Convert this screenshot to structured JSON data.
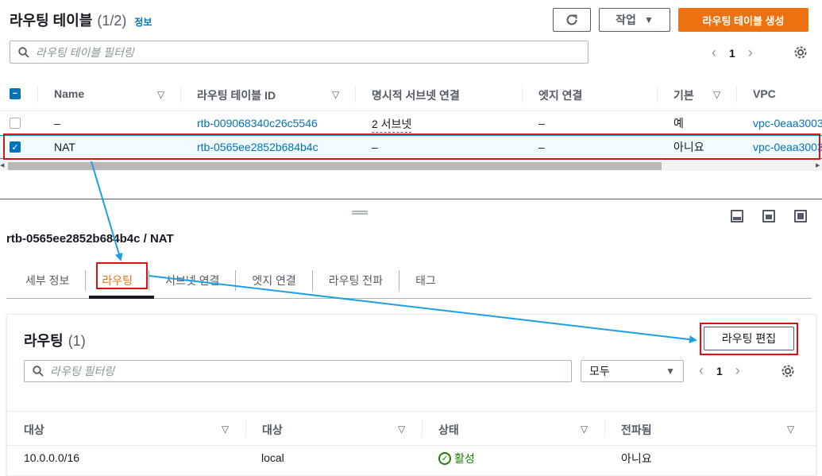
{
  "header": {
    "title": "라우팅 테이블",
    "count": "(1/2)",
    "info_link": "정보",
    "actions_label": "작업",
    "create_label": "라우팅 테이블 생성"
  },
  "search": {
    "placeholder": "라우팅 테이블 필터링"
  },
  "pagination": {
    "page": "1"
  },
  "table": {
    "columns": [
      "Name",
      "라우팅 테이블 ID",
      "명시적 서브넷 연결",
      "엣지 연결",
      "기본",
      "VPC"
    ],
    "rows": [
      {
        "selected": false,
        "name": "–",
        "id": "rtb-009068340c26c5546",
        "subnet": "2 서브넷",
        "edge": "–",
        "main": "예",
        "vpc": "vpc-0eaa3003"
      },
      {
        "selected": true,
        "name": "NAT",
        "id": "rtb-0565ee2852b684b4c",
        "subnet": "–",
        "edge": "–",
        "main": "아니요",
        "vpc": "vpc-0eaa3003"
      }
    ]
  },
  "detail": {
    "title": "rtb-0565ee2852b684b4c / NAT",
    "tabs": [
      "세부 정보",
      "라우팅",
      "서브넷 연결",
      "엣지 연결",
      "라우팅 전파",
      "태그"
    ],
    "active_tab": "라우팅"
  },
  "routes": {
    "title": "라우팅",
    "count": "(1)",
    "edit_label": "라우팅 편집",
    "search_placeholder": "라우팅 필터링",
    "filter_value": "모두",
    "page": "1",
    "columns": [
      "대상",
      "대상",
      "상태",
      "전파됨"
    ],
    "rows": [
      {
        "destination": "10.0.0.0/16",
        "target": "local",
        "status": "활성",
        "propagated": "아니요"
      }
    ]
  },
  "colors": {
    "accent": "#ec7211",
    "link": "#0073bb",
    "annotation_box": "#e01010",
    "annotation_arrow": "#1ba1e2",
    "status_ok": "#1d8102"
  }
}
